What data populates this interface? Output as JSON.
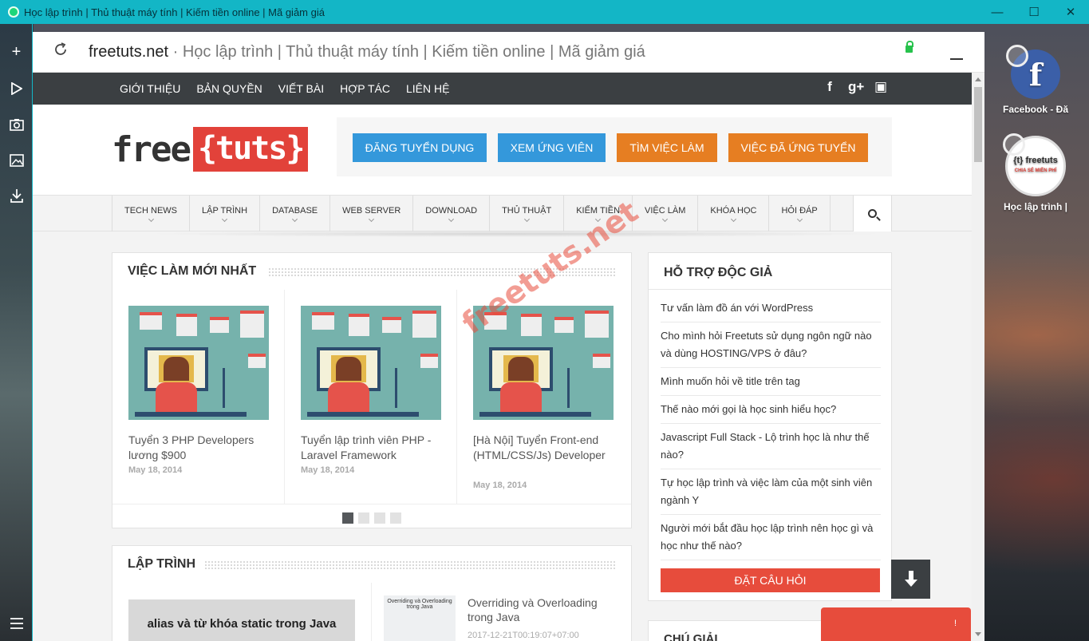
{
  "window": {
    "title": "Học lập trình | Thủ thuật máy tính | Kiếm tiền online | Mã giảm giá",
    "min": "—",
    "max": "☐",
    "close": "✕"
  },
  "rail": {
    "icons": [
      "plus-icon",
      "play-icon",
      "camera-icon",
      "image-icon",
      "download-icon",
      "menu-icon"
    ]
  },
  "address": {
    "domain": "freetuts.net",
    "sep": " · ",
    "page_title": "Học lập trình | Thủ thuật máy tính | Kiếm tiền online | Mã giảm giá"
  },
  "topnav": {
    "links": [
      "GIỚI THIỆU",
      "BẢN QUYỀN",
      "VIẾT BÀI",
      "HỢP TÁC",
      "LIÊN HỆ"
    ],
    "social": [
      "f",
      "g+",
      "▣"
    ]
  },
  "logo": {
    "free": "free",
    "tuts": "{tuts}"
  },
  "job_buttons": [
    {
      "label": "ĐĂNG TUYỂN DỤNG",
      "color": "#3498db"
    },
    {
      "label": "XEM ỨNG VIÊN",
      "color": "#3498db"
    },
    {
      "label": "TÌM VIỆC LÀM",
      "color": "#e67e22"
    },
    {
      "label": "VIỆC ĐÃ ỨNG TUYỂN",
      "color": "#e67e22"
    }
  ],
  "mainnav": [
    "TECH NEWS",
    "LẬP TRÌNH",
    "DATABASE",
    "WEB SERVER",
    "DOWNLOAD",
    "THỦ THUẬT",
    "KIẾM TIỀN",
    "VIỆC LÀM",
    "KHÓA HỌC",
    "HỎI ĐÁP"
  ],
  "jobs": {
    "heading": "VIỆC LÀM MỚI NHẤT",
    "cards": [
      {
        "title": "Tuyển 3 PHP Developers lương $900",
        "date": "May 18, 2014"
      },
      {
        "title": "Tuyển lập trình viên PHP - Laravel Framework",
        "date": "May 18, 2014"
      },
      {
        "title": "[Hà Nội] Tuyển Front-end (HTML/CSS/Js) Developer",
        "date": "May 18, 2014"
      }
    ]
  },
  "watermark": "freetuts.net",
  "support": {
    "heading": "HỖ TRỢ ĐỘC GIẢ",
    "questions": [
      "Tư vấn làm đồ án với WordPress",
      "Cho mình hỏi Freetuts sử dụng ngôn ngữ nào và dùng HOSTING/VPS ở đâu?",
      "Mình muốn hỏi về title trên tag",
      "Thế nào mới gọi là học sinh hiểu học?",
      "Javascript Full Stack - Lộ trình học là như thế nào?",
      "Tự học lập trình và việc làm của một sinh viên ngành Y",
      "Người mới bắt đầu học lập trình nên học gì và học như thế nào?"
    ],
    "ask_button": "ĐẶT CÂU HỎI"
  },
  "programming": {
    "heading": "LẬP TRÌNH",
    "featured": "alias và từ khóa static trong Java",
    "side_thumb": "Overriding và Overloading trong Java",
    "side_title": "Overriding và Overloading trong Java",
    "side_date": "2017-12-21T00:19:07+07:00"
  },
  "chugiai": "CHÚ GIẢI",
  "redbar": "!",
  "speed_dial": [
    {
      "label": "Facebook - Đă",
      "glyph": "f"
    },
    {
      "label": "Học lập trình |",
      "glyph": "{t} freetuts",
      "sub": "CHIA SẺ MIỄN PHÍ"
    }
  ]
}
